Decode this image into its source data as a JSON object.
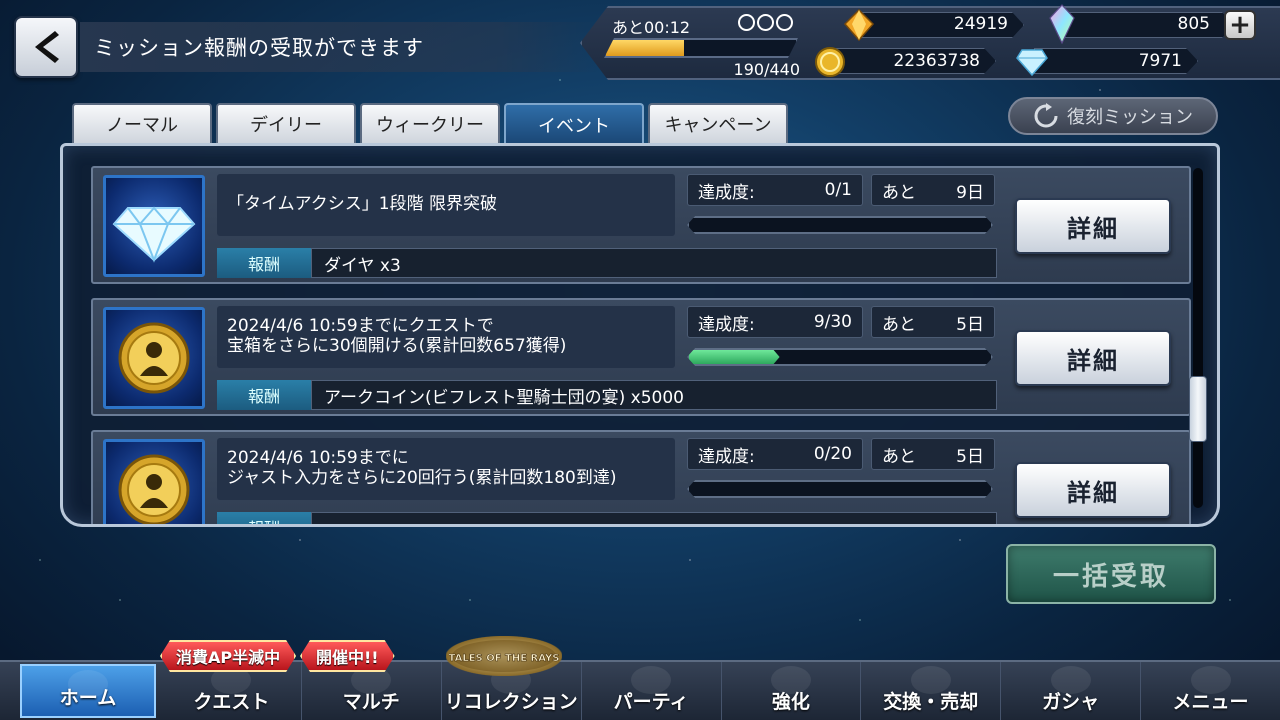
{
  "header": {
    "title": "ミッション報酬の受取ができます",
    "ap_timer": "あと00:12",
    "ap_count": "190/440",
    "ap_fill_fraction": 0.41,
    "currencies": {
      "crystal": "24919",
      "rainbow_crystal": "805",
      "gald": "22363738",
      "diamond": "7971"
    }
  },
  "tabs": [
    {
      "label": "ノーマル",
      "active": false
    },
    {
      "label": "デイリー",
      "active": false
    },
    {
      "label": "ウィークリー",
      "active": false
    },
    {
      "label": "イベント",
      "active": true
    },
    {
      "label": "キャンペーン",
      "active": false
    }
  ],
  "reprint_button": "復刻ミッション",
  "missions": [
    {
      "icon": "diamond-icon",
      "text": "「タイムアクシス」1段階  限界突破",
      "progress_label": "達成度:",
      "progress": "0/1",
      "progress_fraction": 0,
      "remain_label": "あと",
      "remain": "9日",
      "reward_label": "報酬",
      "reward": "ダイヤ x3",
      "detail_label": "詳細"
    },
    {
      "icon": "arc-coin-icon",
      "text": "2024/4/6  10:59までにクエストで\n宝箱をさらに30個開ける(累計回数657獲得)",
      "progress_label": "達成度:",
      "progress": "9/30",
      "progress_fraction": 0.3,
      "remain_label": "あと",
      "remain": "5日",
      "reward_label": "報酬",
      "reward": "アークコイン(ビフレスト聖騎士団の宴) x5000",
      "detail_label": "詳細"
    },
    {
      "icon": "arc-coin-icon",
      "text": "2024/4/6  10:59までに\nジャスト入力をさらに20回行う(累計回数180到達)",
      "progress_label": "達成度:",
      "progress": "0/20",
      "progress_fraction": 0,
      "remain_label": "あと",
      "remain": "5日",
      "reward_label": "報酬",
      "reward": "",
      "detail_label": "詳細"
    }
  ],
  "claim_all_label": "一括受取",
  "nav": [
    {
      "label": "ホーム",
      "active": true
    },
    {
      "label": "クエスト",
      "active": false
    },
    {
      "label": "マルチ",
      "active": false
    },
    {
      "label": "リコレクション",
      "active": false
    },
    {
      "label": "パーティ",
      "active": false
    },
    {
      "label": "強化",
      "active": false
    },
    {
      "label": "交換・売却",
      "active": false
    },
    {
      "label": "ガシャ",
      "active": false
    },
    {
      "label": "メニュー",
      "active": false
    }
  ],
  "badges": {
    "quest": "消費AP半減中",
    "multi": "開催中!!",
    "event_logo": "TALES OF THE RAYS"
  }
}
